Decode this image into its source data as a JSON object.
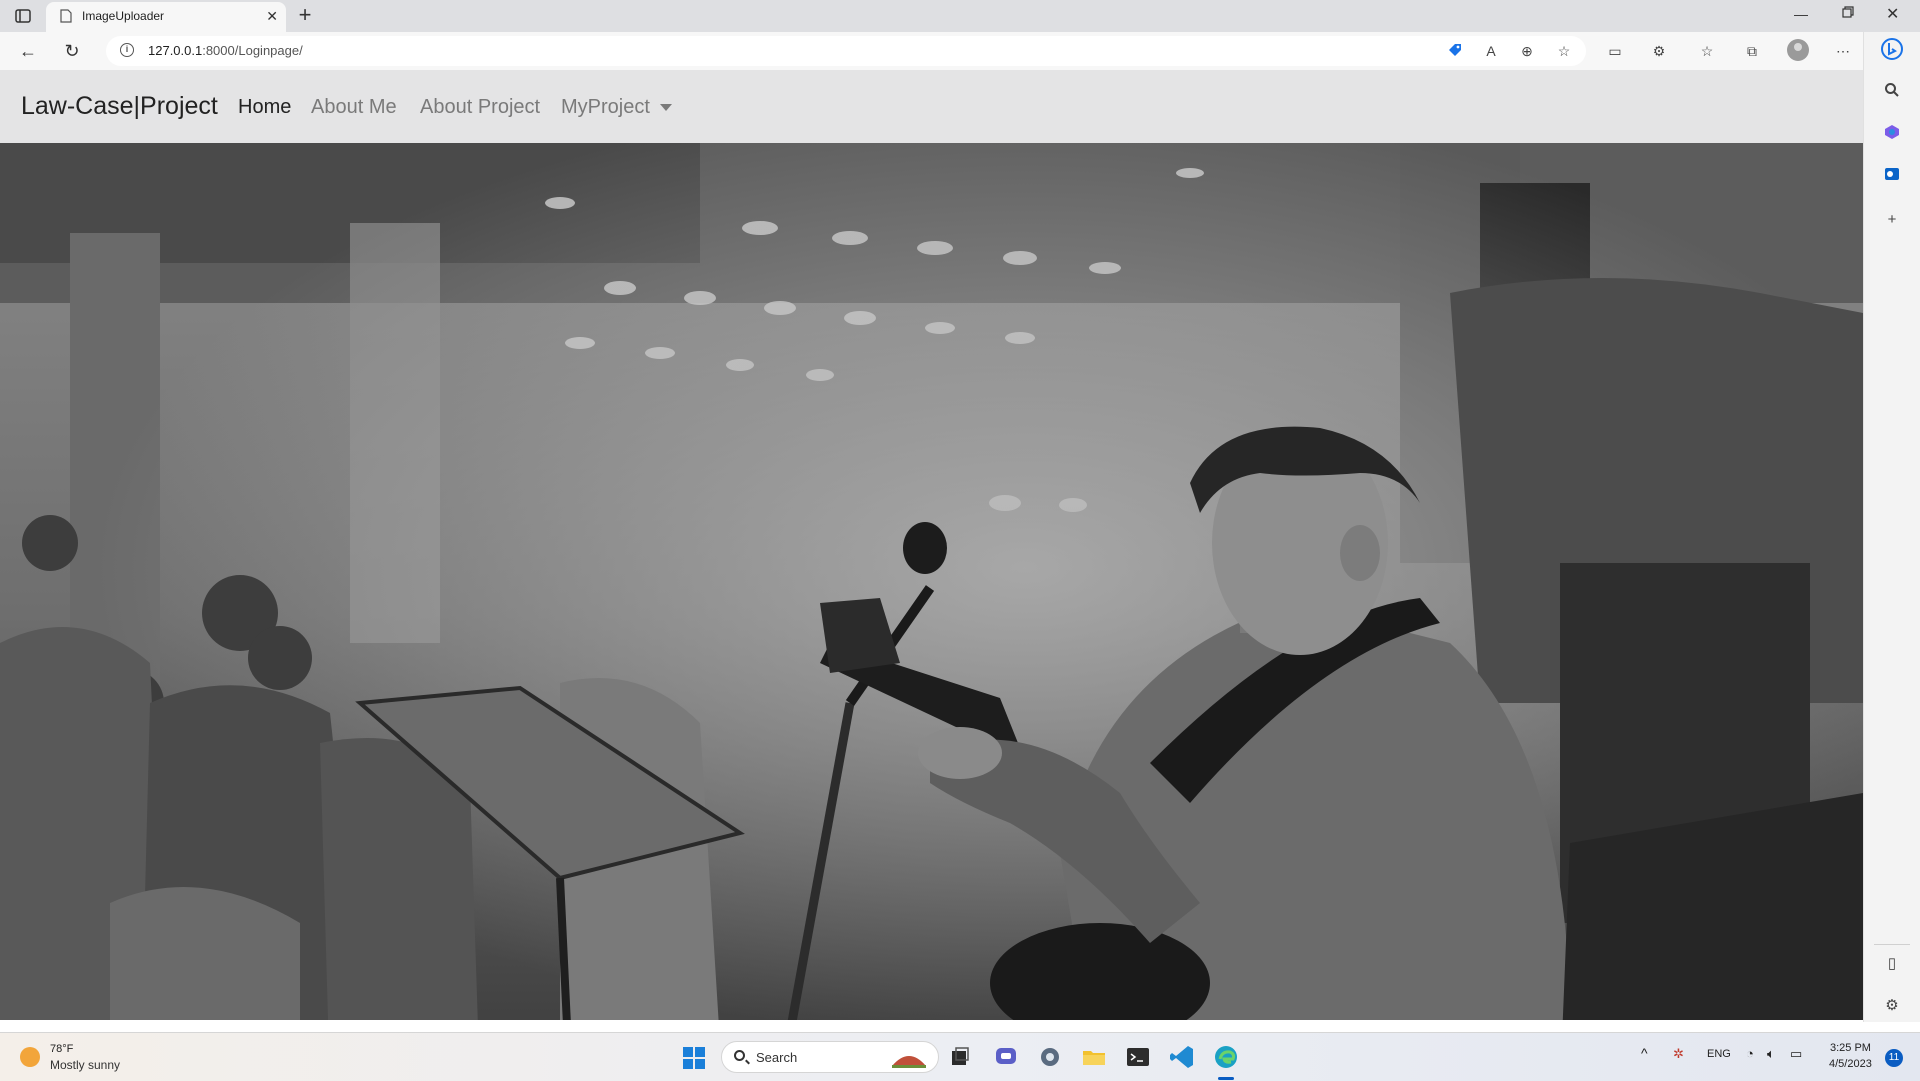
{
  "browser": {
    "tab_title": "ImageUploader",
    "url_host": "127.0.0.1",
    "url_rest": ":8000/Loginpage/"
  },
  "site": {
    "brand": "Law-Case|Project",
    "nav": [
      {
        "label": "Home",
        "active": true
      },
      {
        "label": "About Me",
        "active": false
      },
      {
        "label": "About Project",
        "active": false
      },
      {
        "label": "MyProject",
        "active": false,
        "dropdown": true
      }
    ]
  },
  "taskbar": {
    "weather_temp": "78°F",
    "weather_desc": "Mostly sunny",
    "search_label": "Search",
    "language": "ENG",
    "time": "3:25 PM",
    "date": "4/5/2023",
    "notification_count": "11"
  },
  "colors": {
    "navbar_bg": "#e4e4e5",
    "accent": "#0a5cc2"
  }
}
